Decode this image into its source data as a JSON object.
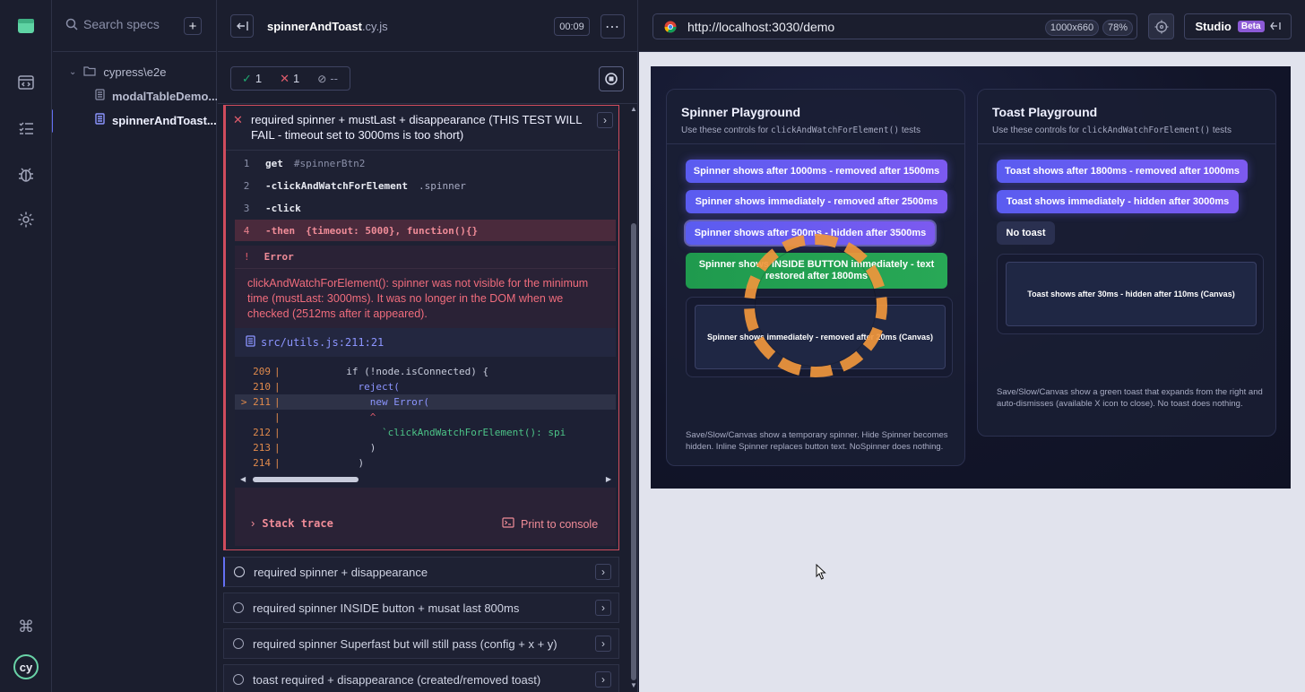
{
  "specs": {
    "search_placeholder": "Search specs",
    "folder": "cypress\\e2e",
    "files": [
      "modalTableDemo...",
      "spinnerAndToast..."
    ]
  },
  "reporter": {
    "file_name": "spinnerAndToast",
    "file_ext": ".cy.js",
    "duration": "00:09",
    "passed": "1",
    "failed": "1",
    "pending": "--",
    "failed_test": {
      "title": "required spinner + mustLast + disappearance (THIS TEST WILL FAIL - timeout set to 3000ms is too short)",
      "commands": [
        {
          "num": "1",
          "name": "get",
          "arg": "#spinnerBtn2"
        },
        {
          "num": "2",
          "name": "-clickAndWatchForElement",
          "arg": ".spinner"
        },
        {
          "num": "3",
          "name": "-click",
          "arg": ""
        },
        {
          "num": "4",
          "name": "-then",
          "arg": "{timeout: 5000}, function(){}"
        }
      ],
      "error_marker": "!",
      "error_label": "Error",
      "error_message": "clickAndWatchForElement(): spinner was not visible for the minimum time (mustLast: 3000ms). It was no longer in the DOM when we checked (2512ms after it appeared).",
      "file_link": "src/utils.js:211:21",
      "code": [
        {
          "ln": "209",
          "text": "          if (!node.isConnected) {"
        },
        {
          "ln": "210",
          "text": "            reject("
        },
        {
          "ln": "> 211",
          "text": "              new Error("
        },
        {
          "ln": "",
          "text": "              ^"
        },
        {
          "ln": "212",
          "text": "                `clickAndWatchForElement(): spi"
        },
        {
          "ln": "213",
          "text": "              )"
        },
        {
          "ln": "214",
          "text": "            )"
        }
      ],
      "stack_trace": "Stack trace",
      "print_console": "Print to console"
    },
    "tests": [
      "required spinner + disappearance",
      "required spinner INSIDE button + musat last 800ms",
      "required spinner Superfast but will still pass (config + x + y)",
      "toast required + disappearance (created/removed toast)"
    ]
  },
  "browser": {
    "url": "http://localhost:3030/demo",
    "viewport": "1000x660",
    "zoom": "78%",
    "studio_label": "Studio",
    "beta_badge": "Beta"
  },
  "app": {
    "spinner": {
      "title": "Spinner Playground",
      "sub_pre": "Use these controls for",
      "sub_code": "clickAndWatchForElement()",
      "sub_post": "tests",
      "buttons": [
        "Spinner shows after 1000ms - removed after 1500ms",
        "Spinner shows immediately - removed after 2500ms",
        "Spinner shows after 500ms - hidden after 3500ms"
      ],
      "inside_button": "Spinner shows INSIDE BUTTON immediately - text restored after 1800ms",
      "canvas_label": "Spinner shows immediately - removed after 20ms (Canvas)",
      "footer": "Save/Slow/Canvas show a temporary spinner. Hide Spinner becomes hidden. Inline Spinner replaces button text. NoSpinner does nothing."
    },
    "toast": {
      "title": "Toast Playground",
      "sub_pre": "Use these controls for",
      "sub_code": "clickAndWatchForElement()",
      "sub_post": "tests",
      "buttons": [
        "Toast shows after 1800ms - removed after 1000ms",
        "Toast shows immediately - hidden after 3000ms"
      ],
      "no_toast": "No toast",
      "canvas_label": "Toast shows after 30ms - hidden after 110ms (Canvas)",
      "footer": "Save/Slow/Canvas show a green toast that expands from the right and auto-dismisses (available X icon to close). No toast does nothing."
    }
  },
  "colors": {
    "accent": "#6470f3",
    "fail": "#cf4c5d",
    "pass": "#1fa971",
    "spinner_orange": "#f0963c",
    "inside_button_green": "#1f9a4e"
  }
}
